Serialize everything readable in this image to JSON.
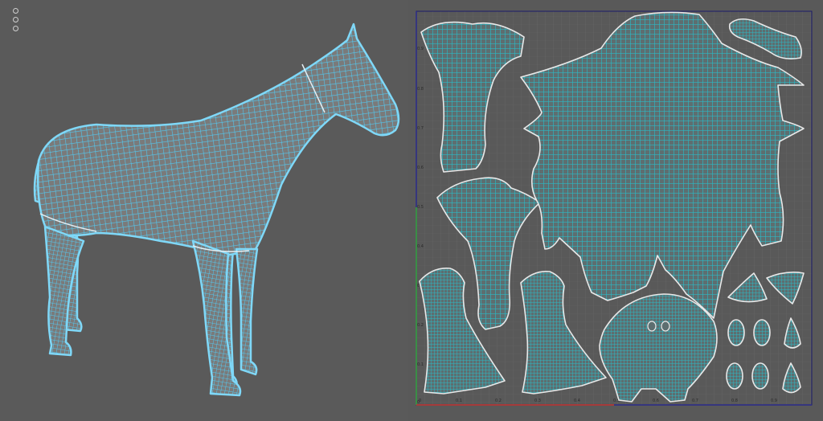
{
  "viewport_3d": {
    "menu_icons": [
      "dot-icon",
      "dot-icon",
      "dot-icon"
    ],
    "mesh": "horse-wireframe",
    "wire_color": "#52c8f0",
    "edge_color": "#cfe6f0"
  },
  "uv_editor": {
    "island_fill": "#2bb8c4",
    "island_outline": "#e8e8e8",
    "grid_bg": "#595959",
    "axis_u_color": "#c03030",
    "axis_v_color": "#30a040",
    "frame_color": "#1c1c6a",
    "v_ticks": [
      "0.9",
      "0.8",
      "0.7",
      "0.6",
      "0.5",
      "0.4",
      "0.3",
      "0.2",
      "0.1",
      "0"
    ],
    "u_ticks": [
      "0",
      "0.1",
      "0.2",
      "0.3",
      "0.4",
      "0.5",
      "0.6",
      "0.7",
      "0.8",
      "0.9"
    ]
  }
}
